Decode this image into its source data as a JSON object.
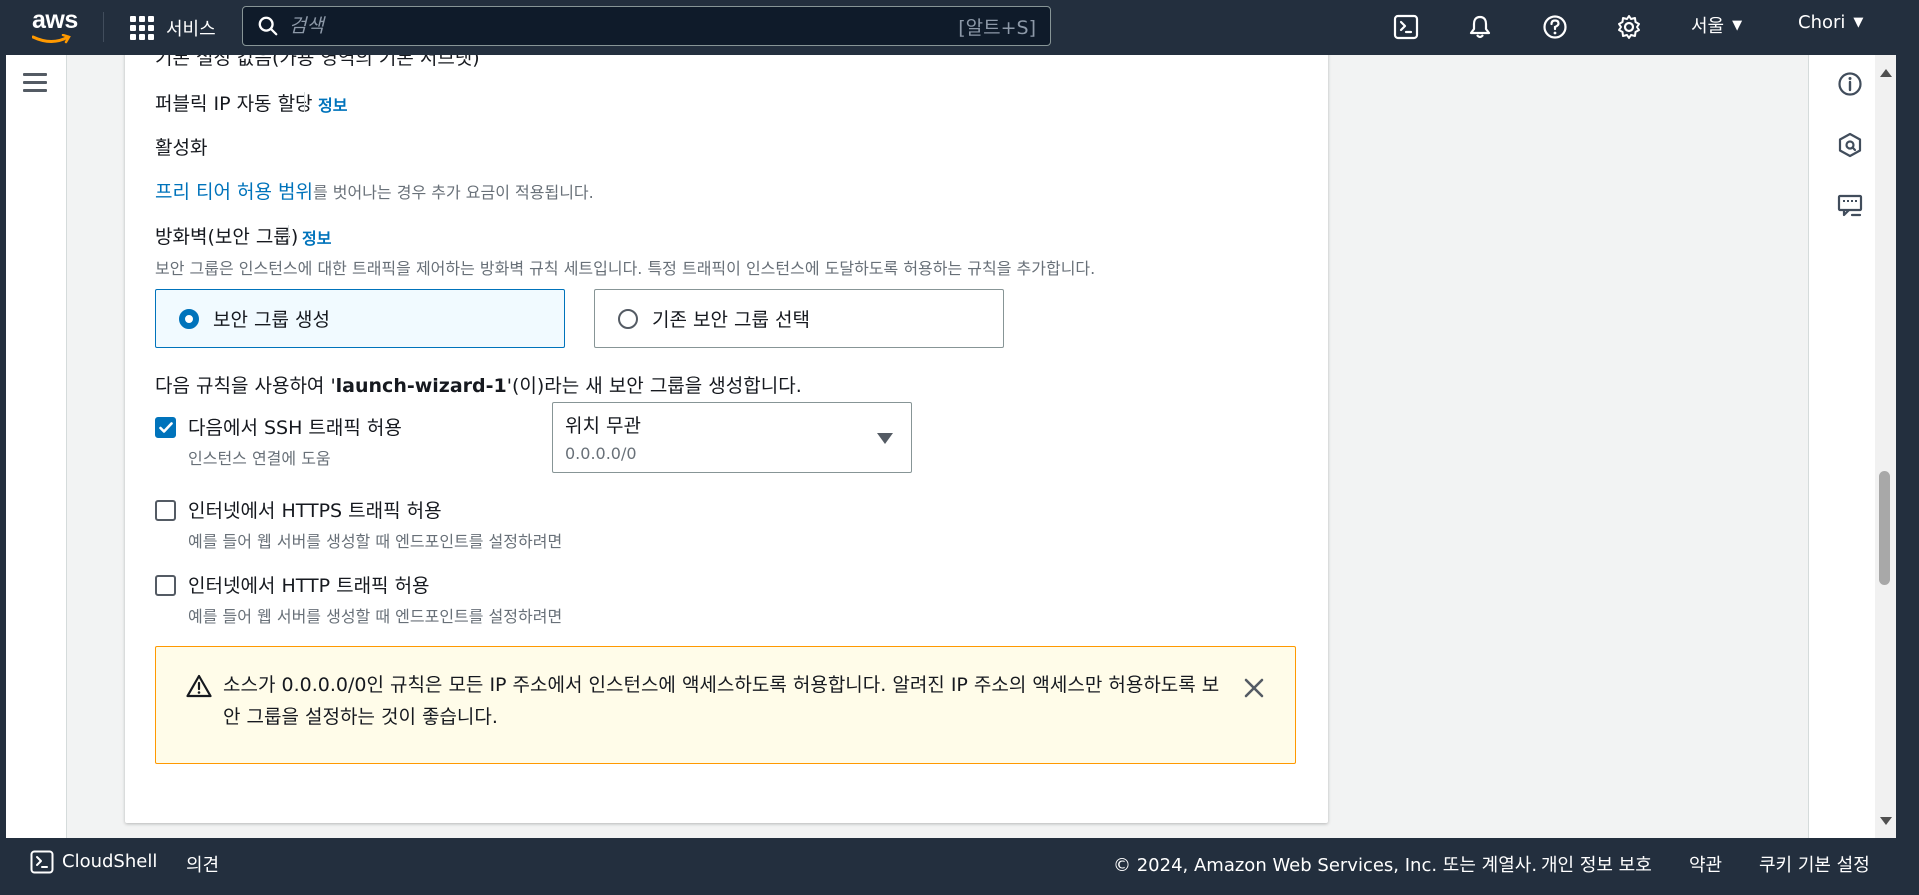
{
  "topnav": {
    "logo_text": "aws",
    "services_label": "서비스",
    "search_placeholder": "검색",
    "search_shortcut": "[알트+S]",
    "region_label": "서울",
    "account_label": "Chori"
  },
  "form": {
    "cut_off_text": "기본 설정 값음(가용 영역의 기본 서브넷)",
    "public_ip_label": "퍼블릭 IP 자동 할당",
    "public_ip_info": "정보",
    "public_ip_value": "활성화",
    "free_tier_link": "프리 티어 허용 범위",
    "free_tier_suffix": "를 벗어나는 경우 추가 요금이 적용됩니다.",
    "firewall_label": "방화벽(보안 그룹)",
    "firewall_info": "정보",
    "firewall_desc": "보안 그룹은 인스턴스에 대한 트래픽을 제어하는 방화벽 규칙 세트입니다. 특정 트래픽이 인스턴스에 도달하도록 허용하는 규칙을 추가합니다.",
    "radio_create": "보안 그룹 생성",
    "radio_existing": "기존 보안 그룹 선택",
    "create_prefix": "다음 규칙을 사용하여 '",
    "create_name": "launch-wizard-1",
    "create_suffix": "'(이)라는 새 보안 그룹을 생성합니다.",
    "ssh_label": "다음에서 SSH 트래픽 허용",
    "ssh_desc": "인스턴스 연결에 도움",
    "ssh_checked": true,
    "source_select_value": "위치 무관",
    "source_select_sub": "0.0.0.0/0",
    "https_label": "인터넷에서 HTTPS 트래픽 허용",
    "https_desc": "예를 들어 웹 서버를 생성할 때 엔드포인트를 설정하려면",
    "https_checked": false,
    "http_label": "인터넷에서 HTTP 트래픽 허용",
    "http_desc": "예를 들어 웹 서버를 생성할 때 엔드포인트를 설정하려면",
    "http_checked": false,
    "warning_text": "소스가 0.0.0.0/0인 규칙은 모든 IP 주소에서 인스턴스에 액세스하도록 허용합니다. 알려진 IP 주소의 액세스만 허용하도록 보안 그룹을 설정하는 것이 좋습니다."
  },
  "footer": {
    "cloudshell": "CloudShell",
    "feedback": "의견",
    "copyright": "© 2024, Amazon Web Services, Inc. 또는 계열사.",
    "privacy": "개인 정보 보호",
    "terms": "약관",
    "cookies": "쿠키 기본 설정"
  },
  "icons": {
    "search": "search-icon",
    "cloudshell": "cloudshell-icon",
    "notifications": "bell-icon",
    "help": "help-icon",
    "settings": "gear-icon",
    "menu": "hamburger-icon",
    "info_panel": "info-icon",
    "security": "shield-icon",
    "feedback_panel": "feedback-icon",
    "warning": "warning-icon",
    "close": "close-icon"
  },
  "colors": {
    "nav_bg": "#232f3e",
    "link": "#0073bb",
    "warning_bg": "#fffce9",
    "warning_border": "#ff9900"
  }
}
